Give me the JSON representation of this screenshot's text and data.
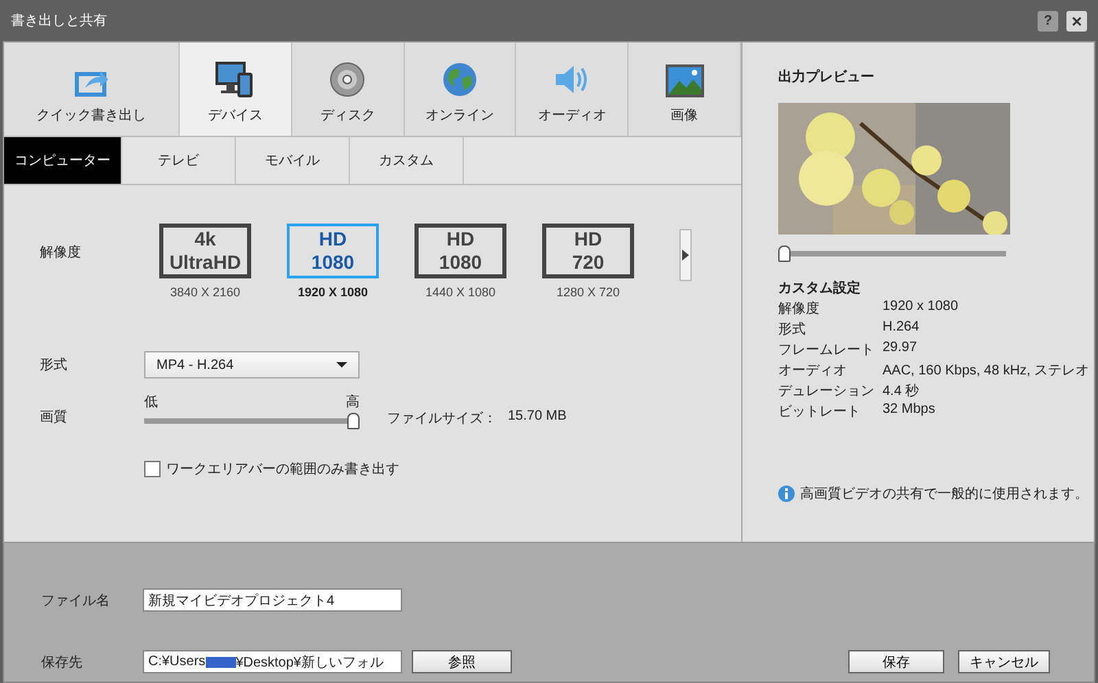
{
  "window": {
    "title": "書き出しと共有",
    "help": "?",
    "close": "×"
  },
  "categories": [
    {
      "label": "クイック書き出し",
      "selected": false
    },
    {
      "label": "デバイス",
      "selected": true
    },
    {
      "label": "ディスク",
      "selected": false
    },
    {
      "label": "オンライン",
      "selected": false
    },
    {
      "label": "オーディオ",
      "selected": false
    },
    {
      "label": "画像",
      "selected": false
    }
  ],
  "subtabs": [
    {
      "label": "コンピューター",
      "selected": true
    },
    {
      "label": "テレビ",
      "selected": false
    },
    {
      "label": "モバイル",
      "selected": false
    },
    {
      "label": "カスタム",
      "selected": false
    }
  ],
  "resolution": {
    "label": "解像度",
    "options": [
      {
        "line1": "4k",
        "line2": "UltraHD",
        "size": "3840 X 2160",
        "selected": false
      },
      {
        "line1": "HD",
        "line2": "1080",
        "size": "1920 X 1080",
        "selected": true
      },
      {
        "line1": "HD",
        "line2": "1080",
        "size": "1440 X 1080",
        "selected": false
      },
      {
        "line1": "HD",
        "line2": "720",
        "size": "1280 X 720",
        "selected": false
      }
    ]
  },
  "format": {
    "label": "形式",
    "value": "MP4 - H.264"
  },
  "quality": {
    "label": "画質",
    "low": "低",
    "high": "高",
    "level": 1
  },
  "file_size": {
    "label": "ファイルサイズ：",
    "value": "15.70 MB"
  },
  "work_area_only": {
    "label": "ワークエリアバーの範囲のみ書き出す",
    "checked": false
  },
  "preview": {
    "title": "出力プレビュー",
    "kind": "picture",
    "level": 0
  },
  "custom_settings": {
    "title": "カスタム設定",
    "rows": [
      {
        "label": "解像度",
        "value": "1920 x 1080"
      },
      {
        "label": "形式",
        "value": "H.264"
      },
      {
        "label": "フレームレート",
        "value": "29.97"
      },
      {
        "label": "オーディオ",
        "value": "AAC, 160 Kbps, 48 kHz, ステレオ"
      },
      {
        "label": "デュレーション",
        "value": "4.4 秒"
      },
      {
        "label": "ビットレート",
        "value": "32 Mbps"
      }
    ]
  },
  "info": "高画質ビデオの共有で一般的に使用されます。",
  "file_name": {
    "label": "ファイル名",
    "value": "新規マイビデオプロジェクト4"
  },
  "save_location": {
    "label": "保存先",
    "value_start": "C:¥Users",
    "redacted": true,
    "value_end": "¥Desktop¥新しいフォル",
    "browse": "参照"
  },
  "buttons": [
    "保存",
    "キャンセル"
  ]
}
